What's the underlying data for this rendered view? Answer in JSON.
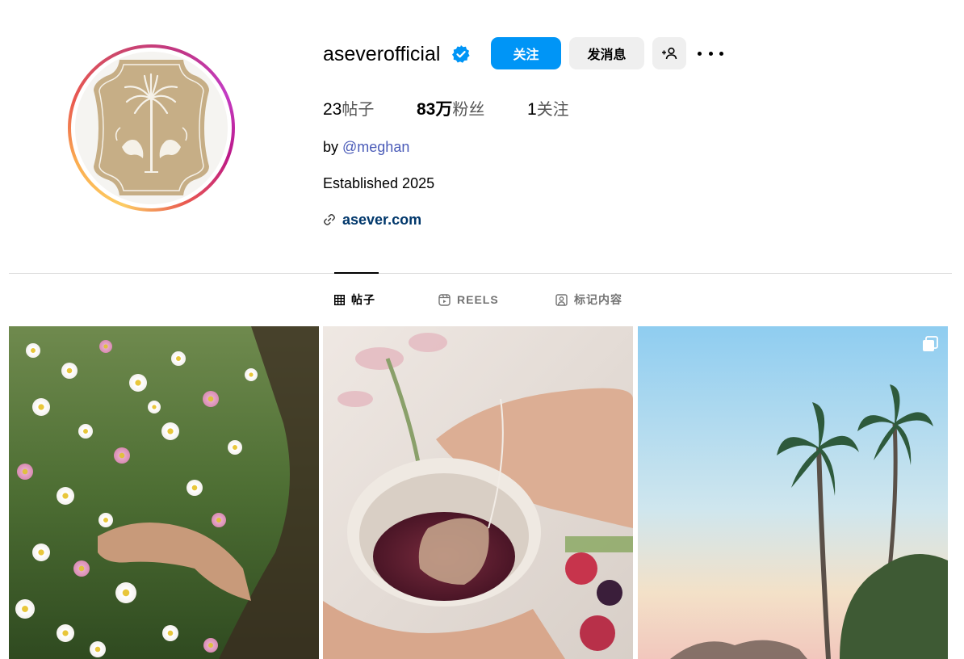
{
  "profile": {
    "username": "aseverofficial",
    "verified": true,
    "avatar_icon": "palm-tree-crest-logo"
  },
  "actions": {
    "follow_label": "关注",
    "message_label": "发消息",
    "add_user_icon": "person-add-icon",
    "more_icon": "more-options-icon"
  },
  "stats": {
    "posts_count": "23",
    "posts_label": "帖子",
    "followers_count": "83万",
    "followers_label": "粉丝",
    "following_count": "1",
    "following_label": "关注"
  },
  "bio": {
    "by_prefix": "by ",
    "mention": "@meghan",
    "tagline": "Established 2025",
    "website": "asever.com"
  },
  "tabs": [
    {
      "label": "帖子",
      "icon": "grid-icon",
      "active": true
    },
    {
      "label": "REELS",
      "icon": "reels-icon",
      "active": false
    },
    {
      "label": "标记内容",
      "icon": "tagged-icon",
      "active": false
    }
  ],
  "posts": [
    {
      "subject": "wildflowers-field",
      "carousel": false
    },
    {
      "subject": "tea-cup-with-bag",
      "carousel": false
    },
    {
      "subject": "palm-trees-sunset",
      "carousel": true
    }
  ],
  "colors": {
    "accent": "#0095f6",
    "link": "#00376b",
    "mention": "#4a5bb8",
    "secondary_button": "#efefef",
    "muted_text": "#737373"
  }
}
